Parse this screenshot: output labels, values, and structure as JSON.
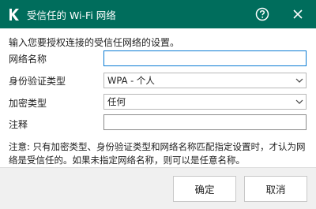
{
  "window": {
    "title": "受信任的 Wi-Fi 网络",
    "brand_color": "#006d5c",
    "icons": [
      "kaspersky-logo",
      "help-icon",
      "close-icon"
    ]
  },
  "form": {
    "intro": "输入您要授权连接的受信任网络的设置。",
    "network_name": {
      "label": "网络名称",
      "value": ""
    },
    "auth_type": {
      "label": "身份验证类型",
      "value": "WPA - 个人"
    },
    "encryption_type": {
      "label": "加密类型",
      "value": "任何"
    },
    "comment": {
      "label": "注释",
      "value": ""
    }
  },
  "note": "注意: 只有加密类型、身份验证类型和网络名称匹配指定设置时，才认为网络是受信任的。如果未指定网络名称，则可以是任意名称。",
  "footer": {
    "ok_label": "确定",
    "cancel_label": "取消"
  }
}
